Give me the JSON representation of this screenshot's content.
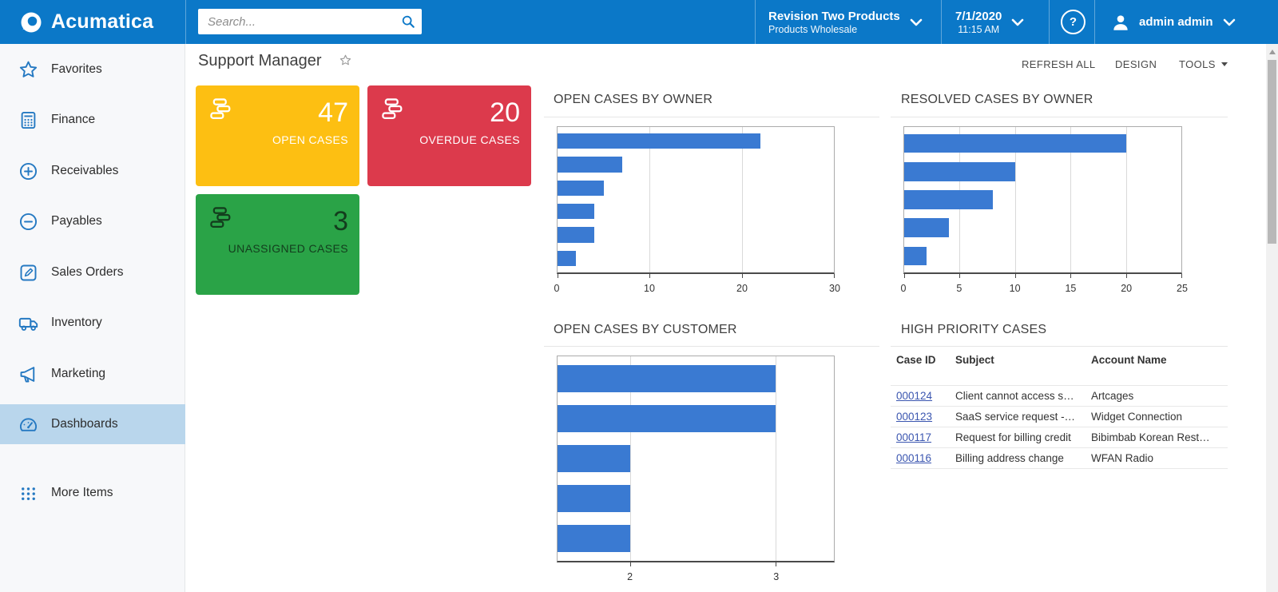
{
  "header": {
    "logo_text": "Acumatica",
    "search_placeholder": "Search...",
    "company": {
      "name": "Revision Two Products",
      "sub": "Products Wholesale"
    },
    "datetime": {
      "date": "7/1/2020",
      "time": "11:15 AM"
    },
    "help_glyph": "?",
    "user_name": "admin admin"
  },
  "sidebar": {
    "items": [
      {
        "label": "Favorites",
        "icon": "star-icon"
      },
      {
        "label": "Finance",
        "icon": "calculator-icon"
      },
      {
        "label": "Receivables",
        "icon": "plus-circle-icon"
      },
      {
        "label": "Payables",
        "icon": "minus-circle-icon"
      },
      {
        "label": "Sales Orders",
        "icon": "pencil-icon"
      },
      {
        "label": "Inventory",
        "icon": "truck-icon"
      },
      {
        "label": "Marketing",
        "icon": "megaphone-icon"
      },
      {
        "label": "Dashboards",
        "icon": "gauge-icon",
        "selected": true
      },
      {
        "label": "More Items",
        "icon": "grid-dots-icon"
      }
    ]
  },
  "page": {
    "title": "Support Manager",
    "actions": [
      "REFRESH ALL",
      "DESIGN",
      "TOOLS"
    ]
  },
  "kpis": [
    {
      "value": "47",
      "label": "OPEN CASES",
      "color": "#fdbf12",
      "text_color": "#ffffff"
    },
    {
      "value": "20",
      "label": "OVERDUE CASES",
      "color": "#dc3a4c",
      "text_color": "#ffffff"
    },
    {
      "value": "3",
      "label": "UNASSIGNED CASES",
      "color": "#2aa347",
      "text_color": "#133d1d"
    }
  ],
  "chart_data": [
    {
      "type": "bar",
      "orientation": "horizontal",
      "title": "OPEN CASES BY OWNER",
      "values": [
        22,
        7,
        5,
        4,
        4,
        2
      ],
      "xlim": [
        0,
        30
      ],
      "ticks": [
        0,
        10,
        20,
        30
      ],
      "grid": true,
      "bar_color": "#3a7ad2"
    },
    {
      "type": "bar",
      "orientation": "horizontal",
      "title": "RESOLVED CASES BY OWNER",
      "values": [
        20,
        10,
        8,
        4,
        2
      ],
      "xlim": [
        0,
        25
      ],
      "ticks": [
        0,
        5,
        10,
        15,
        20,
        25
      ],
      "grid": true,
      "bar_color": "#3a7ad2"
    },
    {
      "type": "bar",
      "orientation": "horizontal",
      "title": "OPEN CASES BY CUSTOMER",
      "values": [
        3,
        3,
        2,
        2,
        2
      ],
      "xlim": [
        1.5,
        3.4
      ],
      "ticks": [
        2,
        3
      ],
      "grid": true,
      "bar_color": "#3a7ad2"
    }
  ],
  "table": {
    "title": "HIGH PRIORITY CASES",
    "columns": [
      "Case ID",
      "Subject",
      "Account Name"
    ],
    "rows": [
      {
        "id": "000124",
        "subject": "Client cannot access s…",
        "account": "Artcages"
      },
      {
        "id": "000123",
        "subject": "SaaS service request -…",
        "account": "Widget Connection"
      },
      {
        "id": "000117",
        "subject": "Request for billing credit",
        "account": "Bibimbab Korean Rest…"
      },
      {
        "id": "000116",
        "subject": "Billing address change",
        "account": "WFAN Radio"
      }
    ]
  },
  "colors": {
    "header_blue": "#0b78c8",
    "sidebar_selected": "#b9d6ec",
    "icon_blue": "#2579c2",
    "bar_blue": "#3a7ad2",
    "link_blue": "#3b56b0"
  }
}
